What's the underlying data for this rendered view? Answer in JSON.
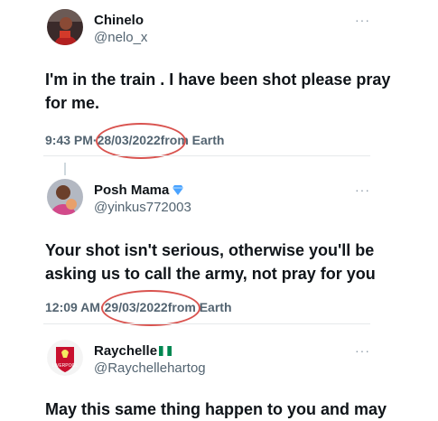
{
  "tweets": [
    {
      "name": "Chinelo",
      "handle": "@nelo_x",
      "text": "I'm in the train .  I have been shot please pray for me.",
      "time": "9:43 PM",
      "sep": " · ",
      "date": "28/03/2022",
      "source": " from Earth",
      "avatar_icon": "profile-photo"
    },
    {
      "name": "Posh Mama",
      "handle": "@yinkus772003",
      "text": "Your shot isn't serious, otherwise you'll be asking us to call the army, not pray for you",
      "time": "12:09 AM",
      "sep": " · ",
      "date": "29/03/2022",
      "source": " from Earth",
      "badge_icon": "diamond-icon",
      "avatar_icon": "profile-photo"
    },
    {
      "name": "Raychelle",
      "handle": "@Raychellehartog",
      "text": "May this same thing happen to you and may",
      "badge_icon": "nigeria-flag-icon",
      "avatar_icon": "liverpool-crest",
      "avatar_text": "LIVERPOOL"
    }
  ],
  "more_label": "···",
  "colors": {
    "circle": "#d9534f",
    "secondary_text": "#536471",
    "liverpool_red": "#c8102e"
  }
}
